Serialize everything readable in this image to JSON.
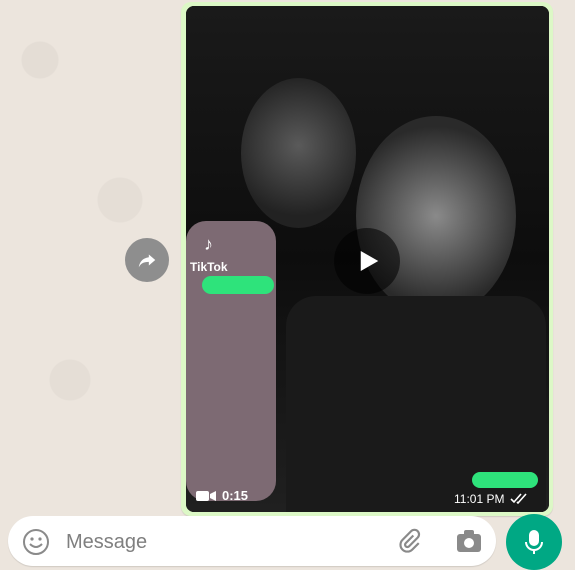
{
  "video": {
    "duration": "0:15",
    "tiktok_label": "TikTok",
    "time": "11:01 PM",
    "status": "read"
  },
  "composer": {
    "placeholder": "Message"
  },
  "icons": {
    "forward": "forward-icon",
    "play": "play-icon",
    "video_camera": "video-camera-icon",
    "emoji": "emoji-icon",
    "attach": "paperclip-icon",
    "camera": "camera-icon",
    "mic": "mic-icon",
    "double_check": "double-check-icon"
  },
  "colors": {
    "bubble": "#dcf8c6",
    "redaction": "#2ee37b",
    "mic_button": "#00a884",
    "wallpaper": "#ece5dd"
  }
}
